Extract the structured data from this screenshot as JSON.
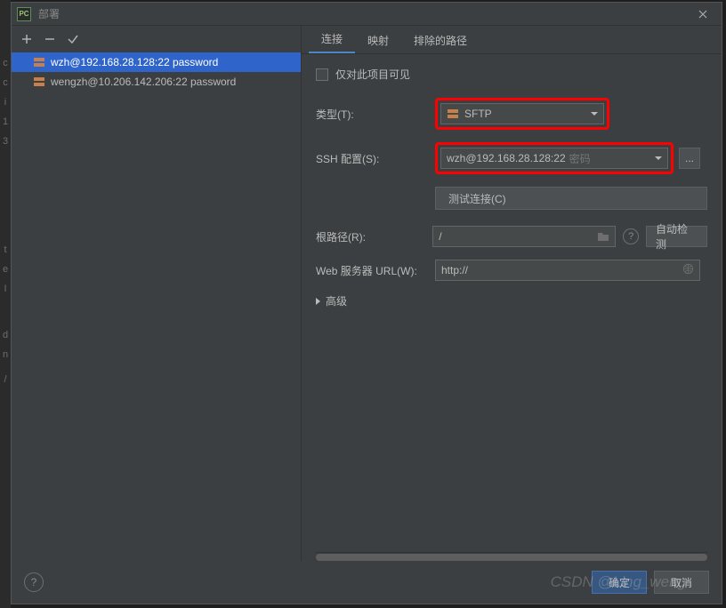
{
  "window": {
    "app_icon_text": "PC",
    "title": "部署"
  },
  "servers": [
    {
      "label": "wzh@192.168.28.128:22 password",
      "selected": true
    },
    {
      "label": "wengzh@10.206.142.206:22 password",
      "selected": false
    }
  ],
  "tabs": {
    "connection": "连接",
    "mapping": "映射",
    "excluded": "排除的路径"
  },
  "form": {
    "visible_only": "仅对此项目可见",
    "type_label": "类型(T):",
    "type_value": "SFTP",
    "ssh_label": "SSH 配置(S):",
    "ssh_value": "wzh@192.168.28.128:22",
    "ssh_suffix": "密码",
    "test_btn": "测试连接(C)",
    "root_label": "根路径(R):",
    "root_value": "/",
    "auto_detect": "自动检测",
    "url_label": "Web 服务器 URL(W):",
    "url_value": "http://",
    "advanced": "高级"
  },
  "footer": {
    "ok": "确定",
    "cancel": "取消"
  },
  "watermark": "CSDN @Ling_weng"
}
